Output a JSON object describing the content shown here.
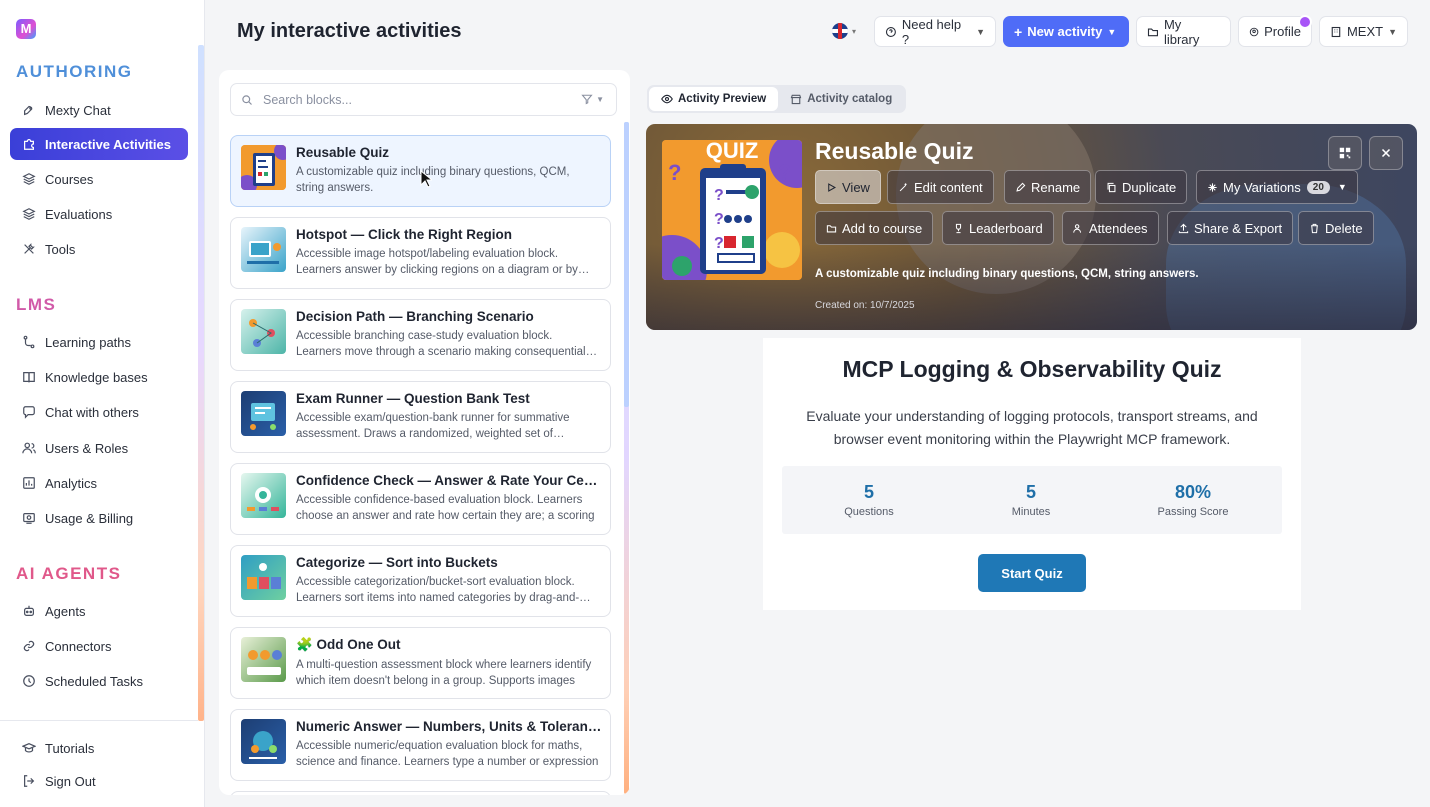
{
  "sidebar": {
    "logo": "M",
    "sections": [
      {
        "title": "AUTHORING",
        "color": "#4f8fd9"
      },
      {
        "title": "LMS",
        "color": "#d15aa8"
      },
      {
        "title": "AI AGENTS",
        "color": "#e0588a"
      }
    ],
    "authoring_items": [
      {
        "label": "Mexty Chat",
        "icon": "rocket-icon"
      },
      {
        "label": "Interactive Activities",
        "icon": "puzzle-icon",
        "active": true
      },
      {
        "label": "Courses",
        "icon": "layers-icon"
      },
      {
        "label": "Evaluations",
        "icon": "layers-icon"
      },
      {
        "label": "Tools",
        "icon": "tools-icon"
      }
    ],
    "lms_items": [
      {
        "label": "Learning paths",
        "icon": "path-icon"
      },
      {
        "label": "Knowledge bases",
        "icon": "book-icon"
      },
      {
        "label": "Chat with others",
        "icon": "chat-icon"
      },
      {
        "label": "Users & Roles",
        "icon": "users-icon"
      },
      {
        "label": "Analytics",
        "icon": "chart-icon"
      },
      {
        "label": "Usage & Billing",
        "icon": "billing-icon"
      }
    ],
    "agent_items": [
      {
        "label": "Agents",
        "icon": "bot-icon"
      },
      {
        "label": "Connectors",
        "icon": "link-icon"
      },
      {
        "label": "Scheduled Tasks",
        "icon": "clock-icon"
      }
    ],
    "footer_items": [
      {
        "label": "Tutorials",
        "icon": "grad-icon"
      },
      {
        "label": "Sign Out",
        "icon": "signout-icon"
      }
    ]
  },
  "header": {
    "title": "My interactive activities",
    "help": "Need help ?",
    "new_activity": "New activity",
    "library": "My library",
    "profile": "Profile",
    "org": "MEXT"
  },
  "search": {
    "placeholder": "Search blocks..."
  },
  "activities": [
    {
      "title": "Reusable Quiz",
      "desc": "A customizable quiz including binary questions, QCM, string answers.",
      "selected": true,
      "thumb": "#f29a2e"
    },
    {
      "title": "Hotspot — Click the Right Region",
      "desc": "Accessible image hotspot/labeling evaluation block. Learners answer by clicking regions on a diagram or by keyboard",
      "thumb": "#3aa3c9"
    },
    {
      "title": "Decision Path — Branching Scenario",
      "desc": "Accessible branching case-study evaluation block. Learners move through a scenario making consequential choices",
      "thumb": "#4db5a8"
    },
    {
      "title": "Exam Runner — Question Bank Test",
      "desc": "Accessible exam/question-bank runner for summative assessment. Draws a randomized, weighted set of questions",
      "thumb": "#2a5fa8"
    },
    {
      "title": "Confidence Check — Answer & Rate Your Certainty",
      "desc": "Accessible confidence-based evaluation block. Learners choose an answer and rate how certain they are; a scoring",
      "thumb": "#35b59a"
    },
    {
      "title": "Categorize — Sort into Buckets",
      "desc": "Accessible categorization/bucket-sort evaluation block. Learners sort items into named categories by drag-and-drop",
      "thumb": "#2f9ec4"
    },
    {
      "title": "🧩 Odd One Out",
      "desc": "A multi-question assessment block where learners identify which item doesn't belong in a group. Supports images",
      "thumb": "#5a9a4a"
    },
    {
      "title": "Numeric Answer — Numbers, Units & Tolerances",
      "desc": "Accessible numeric/equation evaluation block for maths, science and finance. Learners type a number or expression",
      "thumb": "#1d3e73"
    }
  ],
  "tabs": {
    "preview": "Activity Preview",
    "catalog": "Activity catalog"
  },
  "hero": {
    "title": "Reusable Quiz",
    "image_text": "QUIZ",
    "buttons": {
      "view": "View",
      "edit": "Edit content",
      "rename": "Rename",
      "duplicate": "Duplicate",
      "variations": "My Variations",
      "variations_count": "20",
      "add_course": "Add to course",
      "leaderboard": "Leaderboard",
      "attendees": "Attendees",
      "share": "Share & Export",
      "delete": "Delete"
    },
    "desc": "A customizable quiz including binary questions, QCM, string answers.",
    "created": "Created on: 10/7/2025"
  },
  "quiz": {
    "title": "MCP Logging & Observability Quiz",
    "desc": "Evaluate your understanding of logging protocols, transport streams, and browser event monitoring within the Playwright MCP framework.",
    "stats": [
      {
        "value": "5",
        "label": "Questions"
      },
      {
        "value": "5",
        "label": "Minutes"
      },
      {
        "value": "80%",
        "label": "Passing Score"
      }
    ],
    "start": "Start Quiz"
  }
}
